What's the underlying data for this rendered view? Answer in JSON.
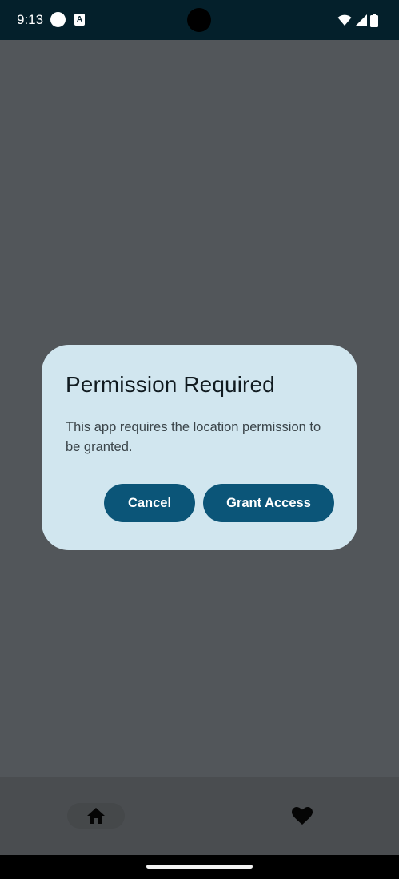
{
  "status_bar": {
    "time": "9:13",
    "notification_icon": "A",
    "icons": [
      "circle-icon",
      "a-icon",
      "wifi-icon",
      "signal-icon",
      "battery-icon"
    ]
  },
  "dialog": {
    "title": "Permission Required",
    "message": "This app requires the location permission to be granted.",
    "cancel_label": "Cancel",
    "grant_label": "Grant Access"
  },
  "bottom_nav": {
    "items": [
      {
        "icon": "home-icon",
        "selected": true
      },
      {
        "icon": "heart-icon",
        "selected": false
      }
    ]
  },
  "colors": {
    "scrim": "#52565a",
    "status_bar": "#04202b",
    "dialog_bg": "#d1e6ef",
    "button": "#0b5578",
    "button_text": "#ffffff",
    "title_text": "#111b20"
  }
}
